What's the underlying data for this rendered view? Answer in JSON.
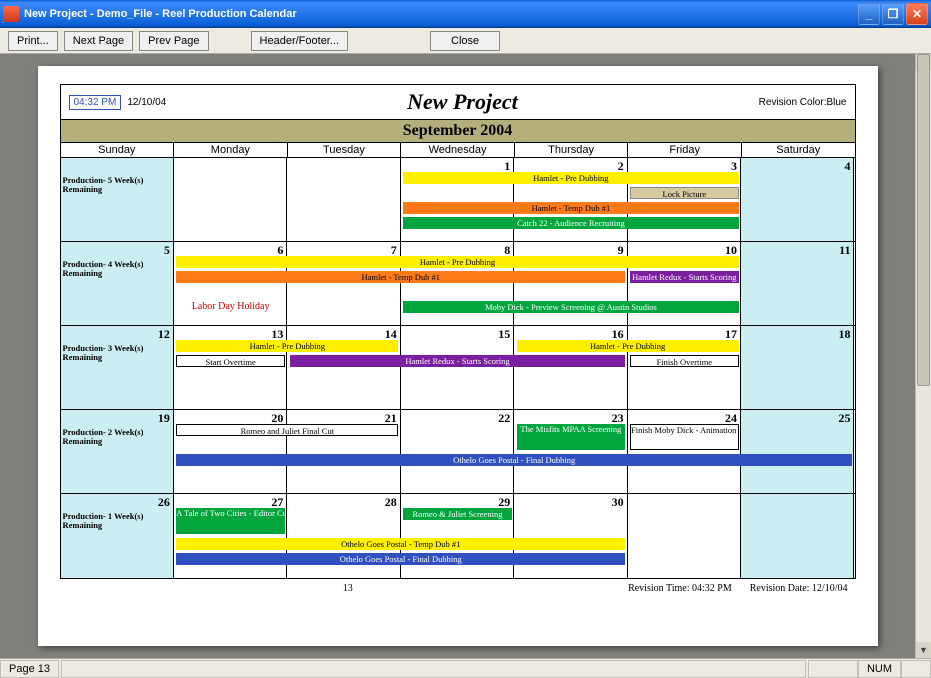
{
  "window": {
    "title": "New Project - Demo_File - Reel Production Calendar"
  },
  "toolbar": {
    "print": "Print...",
    "next": "Next Page",
    "prev": "Prev Page",
    "header_footer": "Header/Footer...",
    "close": "Close"
  },
  "report": {
    "time_box": "04:32 PM",
    "date": "12/10/04",
    "title": "New Project",
    "revision_color": "Revision Color:Blue",
    "month": "September 2004",
    "days": [
      "Sunday",
      "Monday",
      "Tuesday",
      "Wednesday",
      "Thursday",
      "Friday",
      "Saturday"
    ],
    "page_num": "13",
    "rev_time": "Revision Time: 04:32 PM",
    "rev_date": "Revision Date: 12/10/04"
  },
  "weeks": [
    {
      "label": "Production- 5 Week(s) Remaining",
      "cells": [
        {
          "n": "",
          "shade": true
        },
        {
          "n": "",
          "shade": false
        },
        {
          "n": "",
          "shade": false
        },
        {
          "n": "1",
          "shade": false
        },
        {
          "n": "2",
          "shade": false
        },
        {
          "n": "3",
          "shade": false
        },
        {
          "n": "4",
          "shade": true
        }
      ],
      "bars": [
        {
          "text": "Hamlet - Pre Dubbing",
          "color": "yellow",
          "start": 3,
          "span": 3,
          "row": 0
        },
        {
          "text": "Lock Picture",
          "color": "tan",
          "start": 5,
          "span": 1,
          "row": 1
        },
        {
          "text": "Hamlet - Temp Dub #1",
          "color": "orange",
          "start": 3,
          "span": 3,
          "row": 2
        },
        {
          "text": "Catch 22 - Audience Recruiting",
          "color": "green",
          "start": 3,
          "span": 3,
          "row": 3
        }
      ]
    },
    {
      "label": "Production- 4 Week(s) Remaining",
      "cells": [
        {
          "n": "5",
          "shade": true
        },
        {
          "n": "6",
          "shade": false
        },
        {
          "n": "7",
          "shade": false
        },
        {
          "n": "8",
          "shade": false
        },
        {
          "n": "9",
          "shade": false
        },
        {
          "n": "10",
          "shade": false
        },
        {
          "n": "11",
          "shade": true
        }
      ],
      "bars": [
        {
          "text": "Hamlet - Pre Dubbing",
          "color": "yellow",
          "start": 1,
          "span": 5,
          "row": 0
        },
        {
          "text": "Hamlet - Temp Dub #1",
          "color": "orange",
          "start": 1,
          "span": 4,
          "row": 1
        },
        {
          "text": "Hamlet Redux - Starts Scoring",
          "color": "purple",
          "start": 5,
          "span": 1,
          "row": 1
        },
        {
          "text": "Labor Day Holiday",
          "color": "",
          "start": 1,
          "span": 1,
          "row": 3,
          "cls": "redtext"
        },
        {
          "text": "Moby Dick - Preview Screening @ Austin Studios",
          "color": "green",
          "start": 3,
          "span": 3,
          "row": 3
        }
      ]
    },
    {
      "label": "Production- 3 Week(s) Remaining",
      "cells": [
        {
          "n": "12",
          "shade": true
        },
        {
          "n": "13",
          "shade": false
        },
        {
          "n": "14",
          "shade": false
        },
        {
          "n": "15",
          "shade": false
        },
        {
          "n": "16",
          "shade": false
        },
        {
          "n": "17",
          "shade": false
        },
        {
          "n": "18",
          "shade": true
        }
      ],
      "bars": [
        {
          "text": "Hamlet - Pre Dubbing",
          "color": "yellow",
          "start": 1,
          "span": 2,
          "row": 0
        },
        {
          "text": "Hamlet - Pre Dubbing",
          "color": "yellow",
          "start": 4,
          "span": 2,
          "row": 0
        },
        {
          "text": "Start Overtime",
          "color": "white",
          "start": 1,
          "span": 1,
          "row": 1
        },
        {
          "text": "Hamlet Redux - Starts Scoring",
          "color": "purple",
          "start": 2,
          "span": 3,
          "row": 1
        },
        {
          "text": "Finish Overtime",
          "color": "white",
          "start": 5,
          "span": 1,
          "row": 1
        }
      ]
    },
    {
      "label": "Production- 2 Week(s) Remaining",
      "cells": [
        {
          "n": "19",
          "shade": true
        },
        {
          "n": "20",
          "shade": false
        },
        {
          "n": "21",
          "shade": false
        },
        {
          "n": "22",
          "shade": false
        },
        {
          "n": "23",
          "shade": false
        },
        {
          "n": "24",
          "shade": false
        },
        {
          "n": "25",
          "shade": true
        }
      ],
      "bars": [
        {
          "text": "Romeo and Juliet Final Cut",
          "color": "white",
          "start": 1,
          "span": 2,
          "row": 0
        },
        {
          "text": "The Misfits MPAA Screening",
          "color": "green",
          "start": 4,
          "span": 1,
          "row": 0,
          "h": 2
        },
        {
          "text": "Finish Moby Dick - Animation Testing",
          "color": "white",
          "start": 5,
          "span": 1,
          "row": 0,
          "h": 2
        },
        {
          "text": "Othelo Goes Postal - Final Dubbing",
          "color": "blue",
          "start": 1,
          "span": 6,
          "row": 2
        }
      ]
    },
    {
      "label": "Production- 1 Week(s) Remaining",
      "cells": [
        {
          "n": "26",
          "shade": true
        },
        {
          "n": "27",
          "shade": false
        },
        {
          "n": "28",
          "shade": false
        },
        {
          "n": "29",
          "shade": false
        },
        {
          "n": "30",
          "shade": false
        },
        {
          "n": "",
          "shade": false
        },
        {
          "n": "",
          "shade": true
        }
      ],
      "bars": [
        {
          "text": "A Tale of Two Cities - Editor Cut",
          "color": "green",
          "start": 1,
          "span": 1,
          "row": 0,
          "h": 2
        },
        {
          "text": "Romeo & Juliet Screening",
          "color": "green",
          "start": 3,
          "span": 1,
          "row": 0
        },
        {
          "text": "Othelo Goes Postal - Temp Dub #1",
          "color": "yellow",
          "start": 1,
          "span": 4,
          "row": 2
        },
        {
          "text": "Othelo Goes Postal - Final Dubbing",
          "color": "blue",
          "start": 1,
          "span": 4,
          "row": 3
        }
      ]
    }
  ],
  "status": {
    "page": "Page 13",
    "num": "NUM"
  }
}
